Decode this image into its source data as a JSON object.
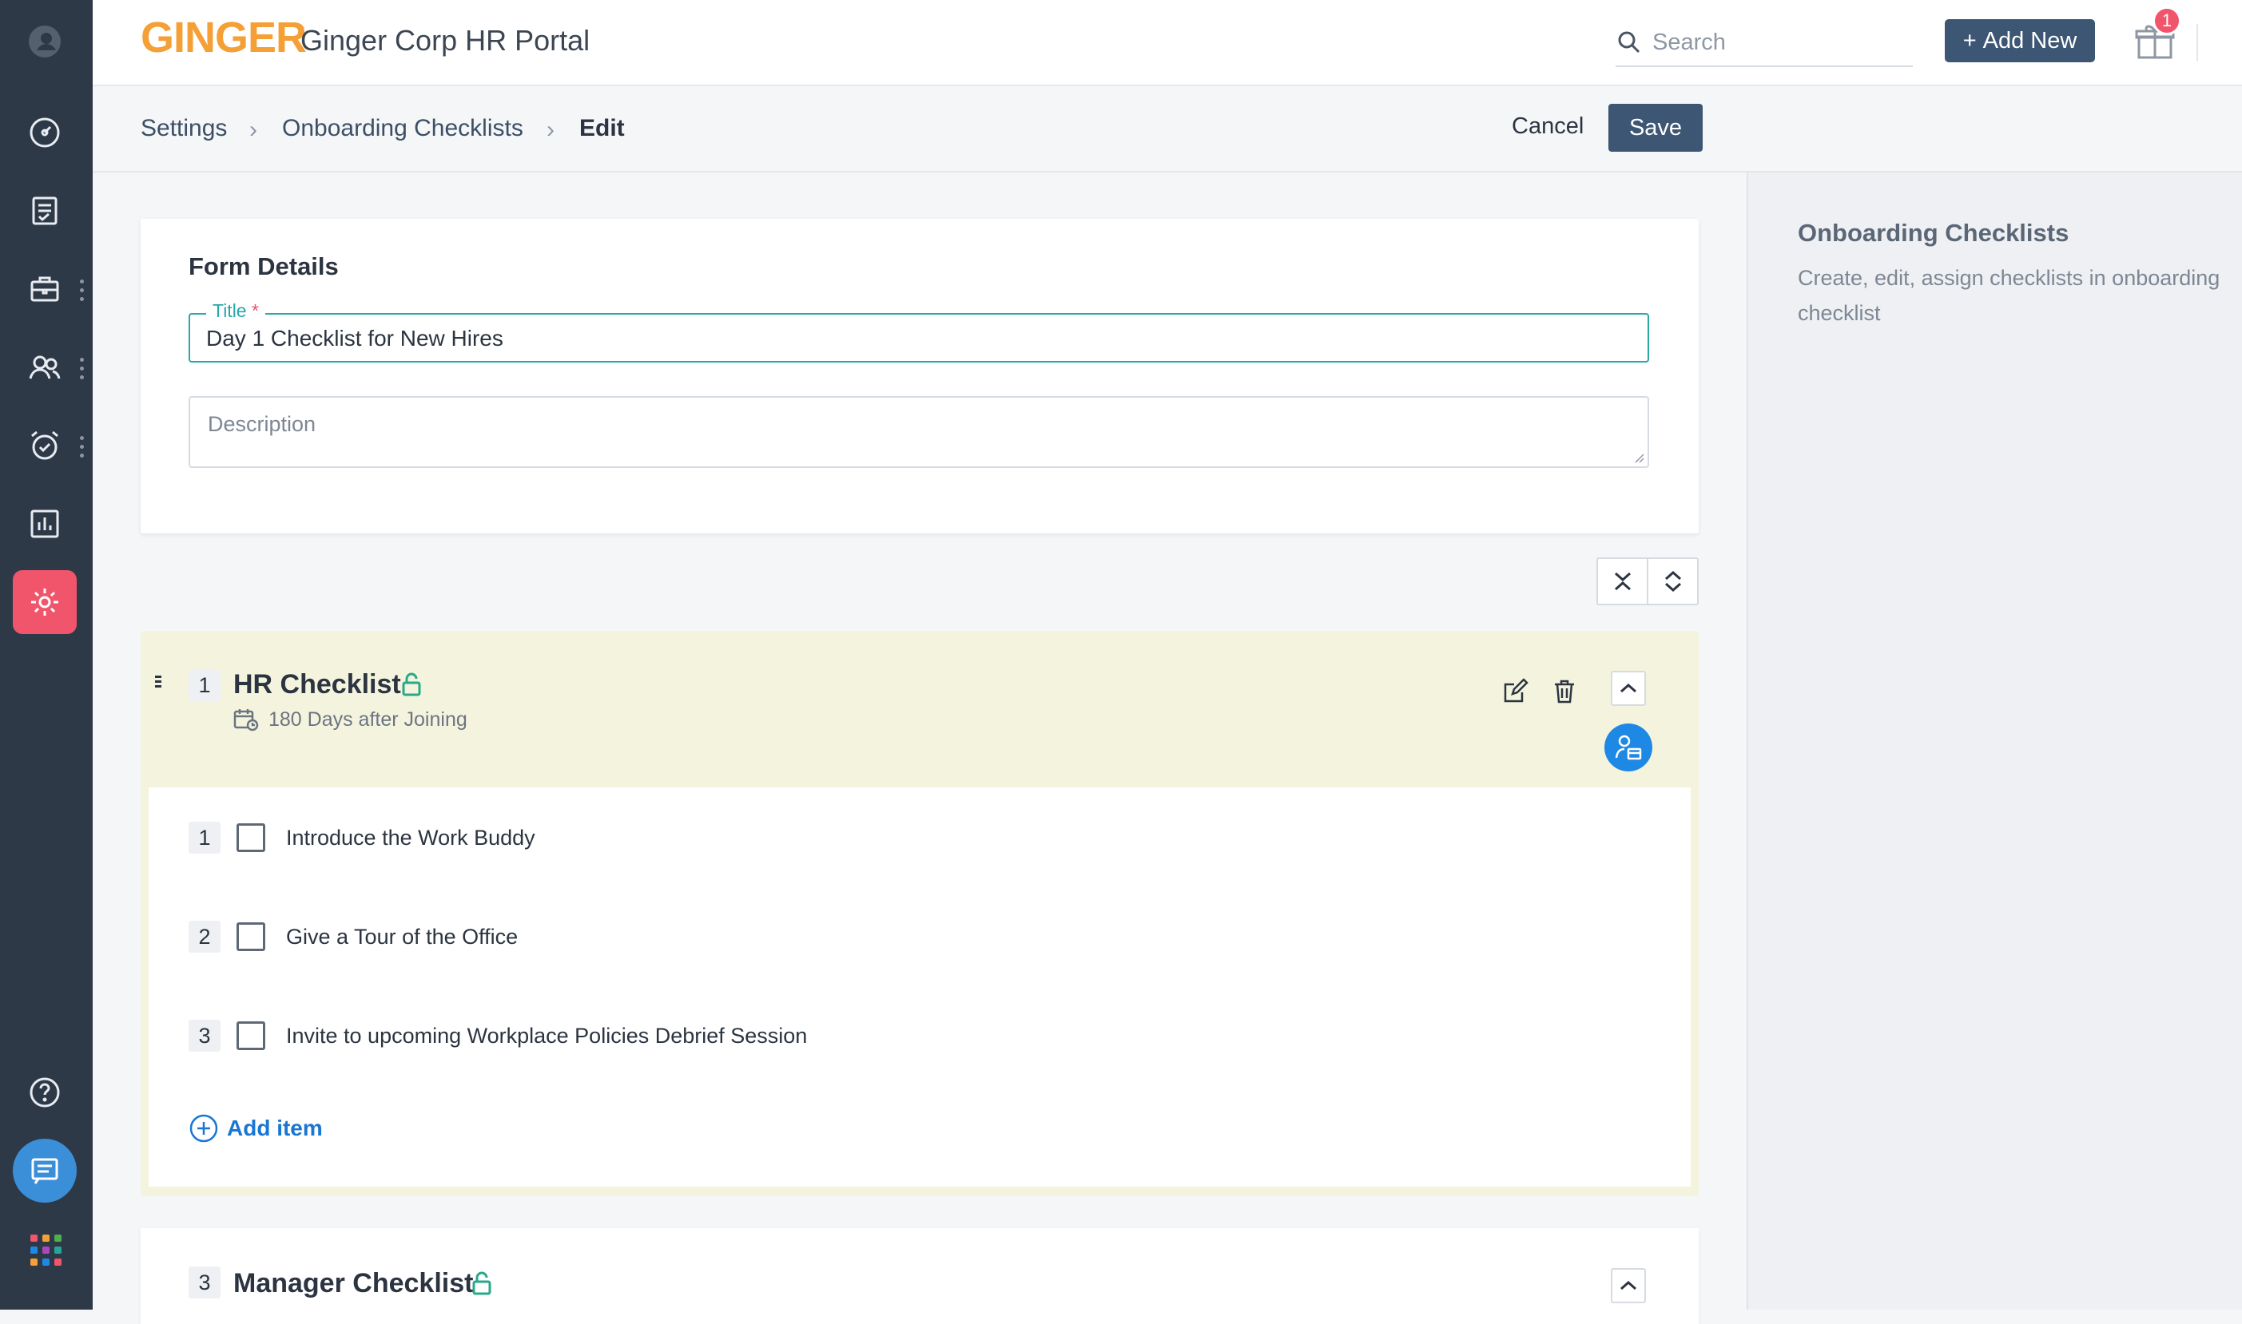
{
  "app": {
    "logo_text": "GINGER",
    "portal_title": "Ginger Corp HR Portal",
    "brand_color": "#f4a036",
    "accent_color": "#3c5673",
    "active_nav_color": "#f0556b"
  },
  "sidebar": {
    "items": [
      {
        "icon": "user-circle-icon"
      },
      {
        "icon": "dashboard-icon"
      },
      {
        "icon": "tasks-icon"
      },
      {
        "icon": "briefcase-icon"
      },
      {
        "icon": "people-icon"
      },
      {
        "icon": "alarm-clock-icon"
      },
      {
        "icon": "reports-icon"
      },
      {
        "icon": "settings-icon",
        "active": true
      },
      {
        "icon": "help-icon"
      },
      {
        "icon": "chat-icon"
      },
      {
        "icon": "apps-grid-icon"
      }
    ]
  },
  "header": {
    "search_placeholder": "Search",
    "add_new_label": "Add New",
    "notification_count": "1"
  },
  "breadcrumb": {
    "items": [
      "Settings",
      "Onboarding Checklists",
      "Edit"
    ],
    "cancel_label": "Cancel",
    "save_label": "Save"
  },
  "form": {
    "heading": "Form Details",
    "title_label": "Title",
    "title_required_mark": "*",
    "title_value": "Day 1 Checklist for New Hires",
    "description_placeholder": "Description"
  },
  "checklists": [
    {
      "number": "1",
      "title": "HR Checklist",
      "due": "180 Days after Joining",
      "items": [
        {
          "number": "1",
          "label": "Introduce the Work Buddy",
          "checked": false
        },
        {
          "number": "2",
          "label": "Give a Tour of the Office",
          "checked": false
        },
        {
          "number": "3",
          "label": "Invite to upcoming Workplace Policies Debrief Session",
          "checked": false
        }
      ],
      "add_item_label": "Add item"
    },
    {
      "number": "3",
      "title": "Manager Checklist"
    }
  ],
  "right_panel": {
    "title": "Onboarding Checklists",
    "description": "Create, edit, assign checklists in onboarding checklist"
  }
}
